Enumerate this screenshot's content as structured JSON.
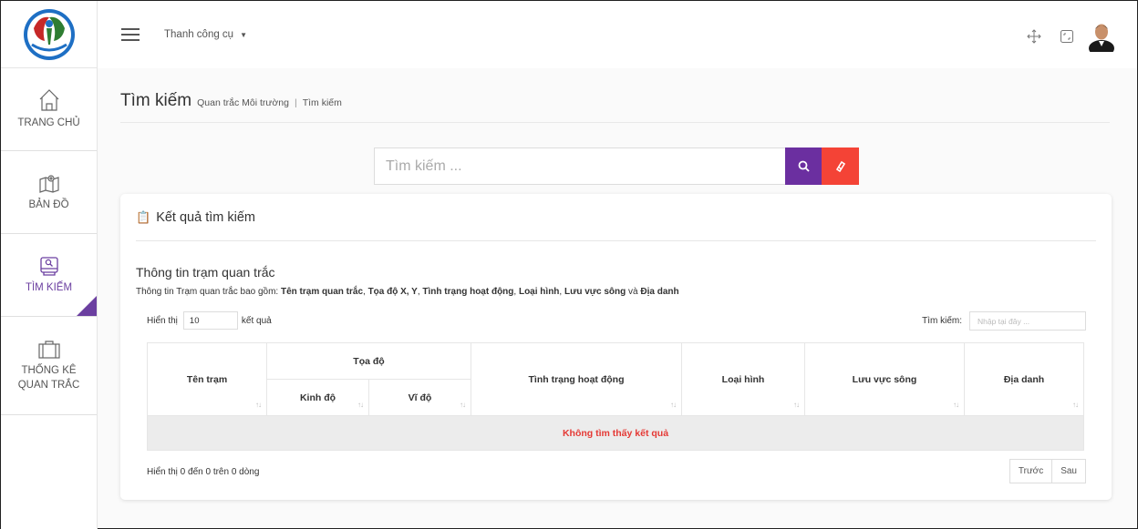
{
  "colors": {
    "accent": "#6b2fa0",
    "danger": "#f44336",
    "empty_text": "#e53935"
  },
  "sidebar": {
    "logo_icon": "ministry-logo-icon",
    "items": [
      {
        "label_line1": "TRANG CHỦ",
        "label_line2": "",
        "icon": "home-icon",
        "active": false
      },
      {
        "label_line1": "BẢN ĐỒ",
        "label_line2": "",
        "icon": "map-icon",
        "active": false
      },
      {
        "label_line1": "TÌM KIẾM",
        "label_line2": "",
        "icon": "search-device-icon",
        "active": true
      },
      {
        "label_line1": "THỐNG KÊ",
        "label_line2": "QUAN TRẮC",
        "icon": "briefcase-icon",
        "active": false
      }
    ]
  },
  "topbar": {
    "menu_icon": "hamburger-icon",
    "toolbar_label": "Thanh công cụ",
    "right_icons": [
      "move-icon",
      "fullscreen-icon",
      "user-avatar"
    ]
  },
  "header": {
    "title": "Tìm kiếm",
    "breadcrumb": [
      "Quan trắc Môi trường",
      "Tìm kiếm"
    ]
  },
  "search": {
    "placeholder": "Tìm kiếm ...",
    "value": ""
  },
  "results": {
    "title": "Kết quả tìm kiếm",
    "section_title": "Thông tin trạm quan trắc",
    "desc_prefix": "Thông tin Trạm quan trắc bao gồm: ",
    "desc_fields": [
      "Tên trạm quan trắc",
      "Tọa độ X, Y",
      "Tình trạng hoạt động",
      "Loại hình",
      "Lưu vực sông",
      "Địa danh"
    ],
    "desc_sep": ", ",
    "desc_and": " và ",
    "length_label_pre": "Hiển thị",
    "length_value": "10",
    "length_label_post": "kết quả",
    "filter_label": "Tìm kiếm:",
    "filter_placeholder": "Nhập tại đây ...",
    "columns": {
      "name": "Tên trạm",
      "coords": "Tọa độ",
      "lng": "Kinh độ",
      "lat": "Vĩ độ",
      "status": "Tình trạng hoạt động",
      "type": "Loại hình",
      "basin": "Lưu vực sông",
      "place": "Địa danh"
    },
    "empty_message": "Không tìm thấy kết quả",
    "info": "Hiển thị 0 đến 0 trên 0 dòng",
    "prev": "Trước",
    "next": "Sau"
  }
}
